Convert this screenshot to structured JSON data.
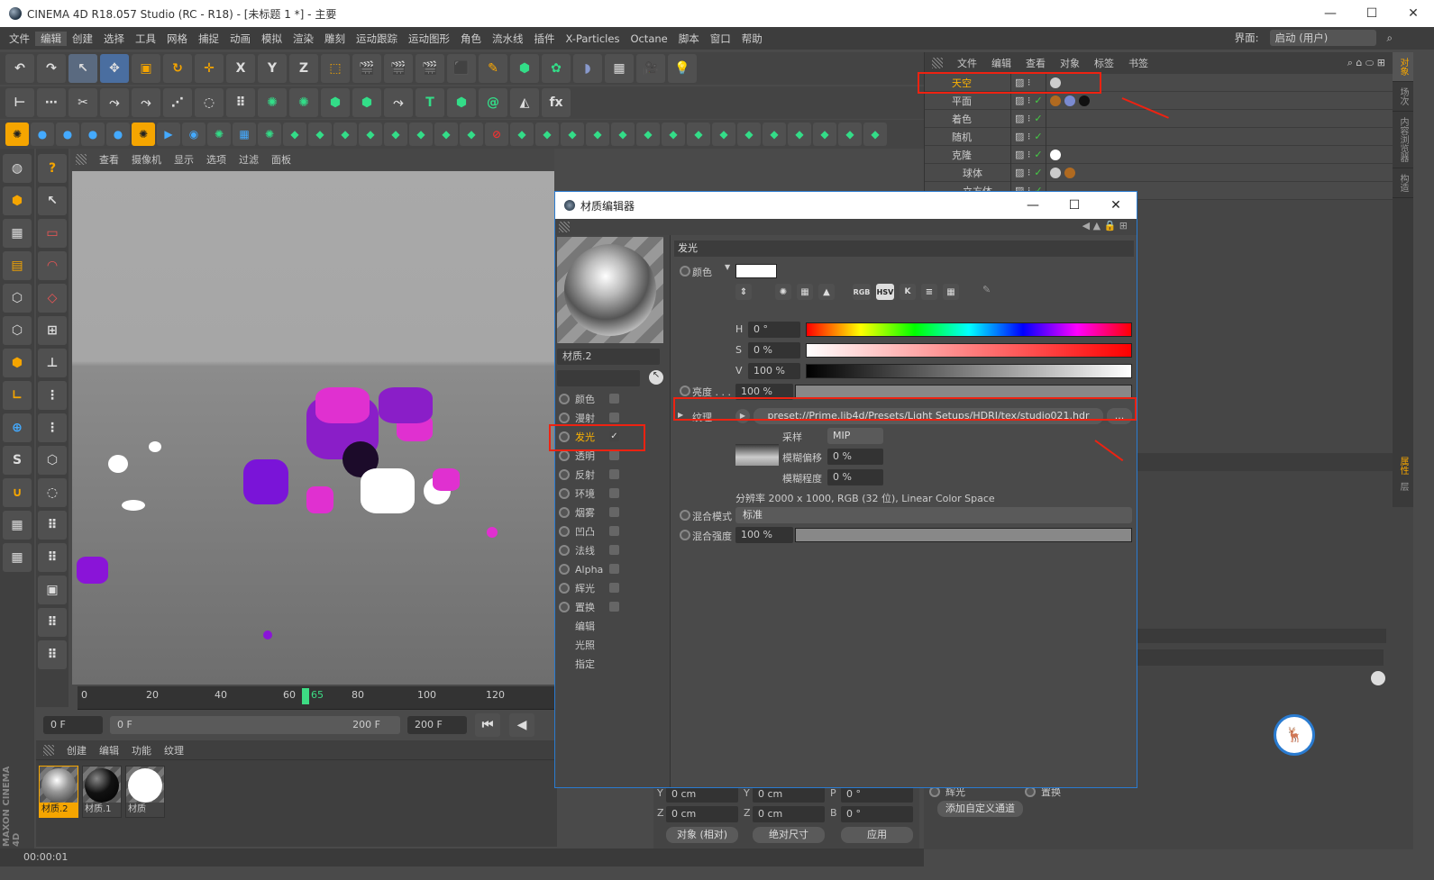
{
  "window": {
    "title": "CINEMA 4D R18.057 Studio (RC - R18) - [未标题 1 *] - 主要",
    "minimize": "—",
    "maximize": "☐",
    "close": "✕"
  },
  "menu": [
    "文件",
    "编辑",
    "创建",
    "选择",
    "工具",
    "网格",
    "捕捉",
    "动画",
    "模拟",
    "渲染",
    "雕刻",
    "运动跟踪",
    "运动图形",
    "角色",
    "流水线",
    "插件",
    "X-Particles",
    "Octane",
    "脚本",
    "窗口",
    "帮助"
  ],
  "interface": {
    "label": "界面:",
    "value": "启动 (用户)"
  },
  "toolbar1": [
    "↶",
    "↷",
    "↖",
    "✥",
    "▣",
    "↻",
    "✛",
    "X",
    "Y",
    "Z",
    "⬚",
    "🎬",
    "🎬",
    "🎬",
    "⬛",
    "✎",
    "⬢",
    "✿",
    "◗",
    "▦",
    "🎥",
    "💡"
  ],
  "viewport": {
    "menu": [
      "查看",
      "摄像机",
      "显示",
      "选项",
      "过滤",
      "面板"
    ]
  },
  "timeline": {
    "ticks": [
      "0",
      "20",
      "40",
      "60",
      "65",
      "80",
      "100",
      "120"
    ],
    "current_frame": "65",
    "start": "0 F",
    "range_start": "0 F",
    "range_end": "200 F",
    "end": "200 F"
  },
  "material_manager": {
    "menu": [
      "创建",
      "编辑",
      "功能",
      "纹理"
    ],
    "materials": [
      {
        "name": "材质.2",
        "selected": true
      },
      {
        "name": "材质.1"
      },
      {
        "name": "材质"
      }
    ]
  },
  "status": {
    "time": "00:00:01"
  },
  "brand": "MAXON CINEMA 4D",
  "object_manager": {
    "menu": [
      "文件",
      "编辑",
      "查看",
      "对象",
      "标签",
      "书签"
    ],
    "objects": [
      {
        "name": "天空",
        "selected": true
      },
      {
        "name": "平面"
      },
      {
        "name": "着色"
      },
      {
        "name": "随机"
      },
      {
        "name": "克隆"
      },
      {
        "name": "球体"
      },
      {
        "name": "立方体"
      }
    ]
  },
  "side_tabs": [
    "对象",
    "场次",
    "内容浏览器",
    "构造"
  ],
  "attr_side_tabs": [
    "属性",
    "层"
  ],
  "coords": {
    "y_pos": "0 cm",
    "z_pos": "0 cm",
    "y_size": "0 cm",
    "z_size": "0 cm",
    "p": "0 °",
    "b": "0 °",
    "labels": [
      "Y",
      "Z",
      "Y",
      "Z",
      "P",
      "B"
    ],
    "mode": "对象 (相对)",
    "size_mode": "绝对尺寸",
    "apply": "应用"
  },
  "attr_bottom": {
    "glow": "辉光",
    "displace": "置换",
    "add_channel": "添加自定义通道"
  },
  "material_editor": {
    "title": "材质编辑器",
    "material_name": "材质.2",
    "channels": [
      {
        "name": "颜色",
        "checked": false
      },
      {
        "name": "漫射",
        "checked": false
      },
      {
        "name": "发光",
        "checked": true
      },
      {
        "name": "透明",
        "checked": false
      },
      {
        "name": "反射",
        "checked": false
      },
      {
        "name": "环境",
        "checked": false
      },
      {
        "name": "烟雾",
        "checked": false
      },
      {
        "name": "凹凸",
        "checked": false
      },
      {
        "name": "法线",
        "checked": false
      },
      {
        "name": "Alpha",
        "checked": false
      },
      {
        "name": "辉光",
        "checked": false
      },
      {
        "name": "置换",
        "checked": false
      }
    ],
    "extra": [
      "编辑",
      "光照",
      "指定"
    ],
    "section": "发光",
    "color_label": "颜色",
    "color_value": "#ffffff",
    "color_modes": [
      "RGB",
      "HSV",
      "K"
    ],
    "h": "0 °",
    "s": "0 %",
    "v": "100 %",
    "brightness_label": "亮度 . . .",
    "brightness": "100 %",
    "texture_label": "纹理 . . .",
    "texture_path": "preset://Prime.lib4d/Presets/Light Setups/HDRI/tex/studio021.hdr",
    "texture_more": "...",
    "sampling_label": "采样",
    "sampling": "MIP",
    "blur_offset_label": "模糊偏移",
    "blur_offset": "0 %",
    "blur_scale_label": "模糊程度",
    "blur_scale": "0 %",
    "resolution": "分辨率 2000 x 1000, RGB (32 位), Linear Color Space",
    "blend_mode_label": "混合模式",
    "blend_mode": "标准",
    "mix_strength_label": "混合强度",
    "mix_strength": "100 %"
  },
  "colors": {
    "accent": "#ffb400",
    "annotation": "#e21f1f",
    "selection_blue": "#2a7bd0",
    "timeline_marker": "#3ddc84"
  }
}
